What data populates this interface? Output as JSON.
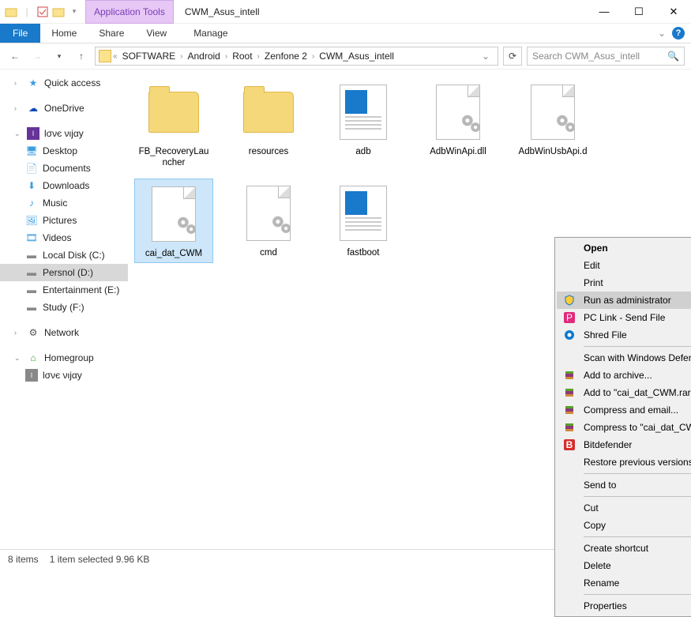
{
  "title": "CWM_Asus_intell",
  "app_tools_label": "Application Tools",
  "ribbon": {
    "file": "File",
    "home": "Home",
    "share": "Share",
    "view": "View",
    "manage": "Manage"
  },
  "breadcrumb": [
    "SOFTWARE",
    "Android",
    "Root",
    "Zenfone 2",
    "CWM_Asus_intell"
  ],
  "search_placeholder": "Search CWM_Asus_intell",
  "sidebar": {
    "quick_access": "Quick access",
    "onedrive": "OneDrive",
    "user": "lσνє νιjαy",
    "user_children": [
      "Desktop",
      "Documents",
      "Downloads",
      "Music",
      "Pictures",
      "Videos",
      "Local Disk (C:)",
      "Persnol (D:)",
      "Entertainment (E:)",
      "Study (F:)"
    ],
    "network": "Network",
    "homegroup": "Homegroup",
    "hg_user": "lσνє νιjαy"
  },
  "files": [
    {
      "name": "FB_RecoveryLauncher",
      "type": "folder"
    },
    {
      "name": "resources",
      "type": "folder"
    },
    {
      "name": "adb",
      "type": "textdoc"
    },
    {
      "name": "AdbWinApi.dll",
      "type": "gearfile"
    },
    {
      "name": "AdbWinUsbApi.d",
      "type": "gearfile"
    },
    {
      "name": "cai_dat_CWM",
      "type": "gearfile",
      "selected": true
    },
    {
      "name": "cmd",
      "type": "gearfile"
    },
    {
      "name": "fastboot",
      "type": "textdoc"
    }
  ],
  "context_menu": {
    "open": "Open",
    "edit": "Edit",
    "print": "Print",
    "runadmin": "Run as administrator",
    "pclink": "PC Link - Send File",
    "shred": "Shred File",
    "defender": "Scan with Windows Defender...",
    "addarchive": "Add to archive...",
    "addrar": "Add to \"cai_dat_CWM.rar\"",
    "compemail": "Compress and email...",
    "comprar": "Compress to \"cai_dat_CWM.rar\" and email",
    "bitdef": "Bitdefender",
    "restore": "Restore previous versions",
    "sendto": "Send to",
    "cut": "Cut",
    "copy": "Copy",
    "shortcut": "Create shortcut",
    "delete": "Delete",
    "rename": "Rename",
    "properties": "Properties"
  },
  "status": {
    "items": "8 items",
    "selected": "1 item selected  9.96 KB"
  }
}
